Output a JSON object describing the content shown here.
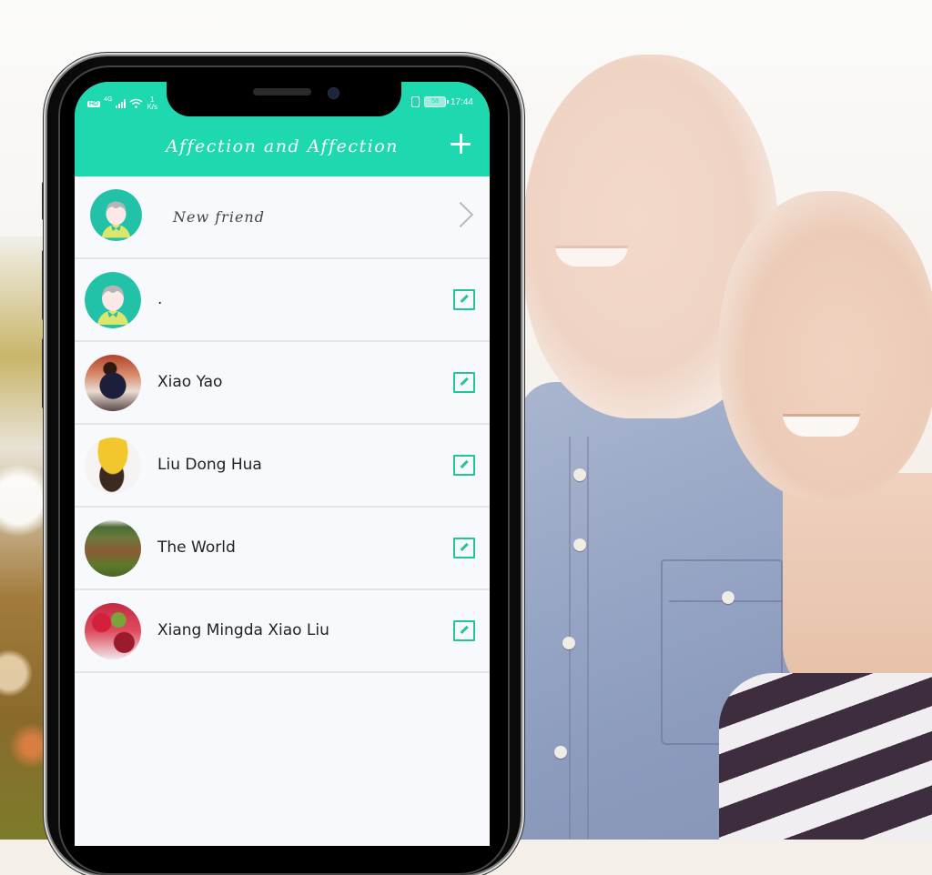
{
  "status_bar": {
    "hd": "HD",
    "network": "4G",
    "net_speed_value": "1",
    "net_speed_unit": "K/s",
    "battery": "58",
    "time": "17:44"
  },
  "header": {
    "title": "Affection and Affection",
    "add_icon": "plus-icon"
  },
  "new_friend": {
    "label": "New friend",
    "icon": "chevron-right-icon"
  },
  "contacts": [
    {
      "name": "."
    },
    {
      "name": "Xiao Yao"
    },
    {
      "name": "Liu Dong Hua"
    },
    {
      "name": "The World"
    },
    {
      "name": "Xiang Mingda Xiao Liu"
    }
  ],
  "colors": {
    "accent": "#1ED8B0",
    "edit_icon": "#22C49C",
    "list_bg": "#F8F9FC",
    "divider": "#E4E5E8"
  }
}
